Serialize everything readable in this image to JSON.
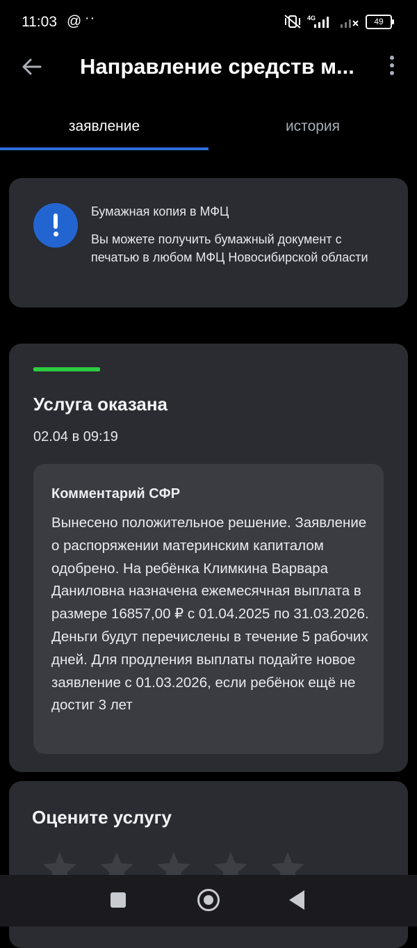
{
  "status_bar": {
    "time": "11:03",
    "at_symbol": "@",
    "dots": "··",
    "network": "4G",
    "battery": "49"
  },
  "app_bar": {
    "title": "Направление средств м...",
    "back_icon": "arrow-left-icon",
    "menu_icon": "more-vertical-icon"
  },
  "tabs": [
    {
      "label": "заявление",
      "active": true
    },
    {
      "label": "история",
      "active": false
    }
  ],
  "info_card": {
    "icon": "exclamation-icon",
    "title": "Бумажная копия в МФЦ",
    "text": "Вы можете получить бумажный документ с печатью в любом МФЦ Новосибирской области"
  },
  "status_card": {
    "accent_color": "#2ecc40",
    "title": "Услуга оказана",
    "date": "02.04 в 09:19",
    "comment": {
      "title": "Комментарий СФР",
      "text": "Вынесено положительное решение. Заявление о распоряжении материнским капиталом одобрено. На ребёнка Климкина Варвара Даниловна назначена ежемесячная выплата в размере 16857,00 ₽ с 01.04.2025 по 31.03.2026. Деньги будут перечислены в течение 5 рабочих дней. Для продления выплаты подайте новое заявление с 01.03.2026, если ребёнок ещё не достиг 3 лет"
    }
  },
  "rating_card": {
    "title": "Оцените услугу",
    "stars_total": 5,
    "stars_selected": 0
  },
  "nav_bar": {
    "buttons": [
      "recent-apps-icon",
      "home-icon",
      "back-triangle-icon"
    ]
  },
  "colors": {
    "background": "#000000",
    "card": "#2a2c31",
    "comment_bg": "#3a3c42",
    "accent_blue": "#2e6fd9",
    "status_green": "#2ecc40"
  }
}
